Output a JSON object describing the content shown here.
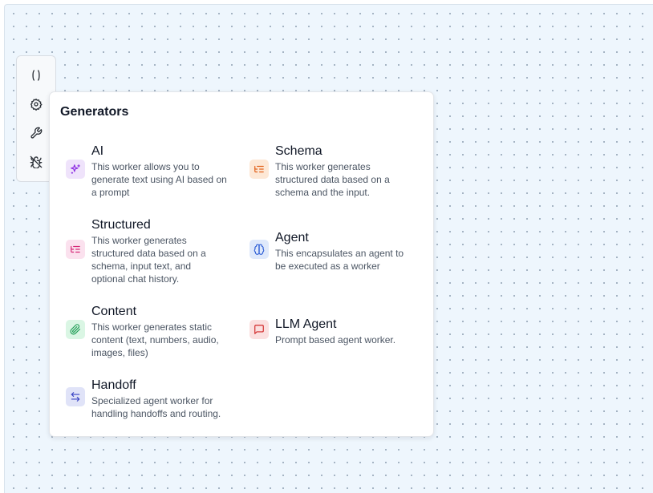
{
  "toolbar": {
    "tools": [
      {
        "icon": "braces-icon"
      },
      {
        "icon": "settings-icon"
      },
      {
        "icon": "wrench-icon"
      },
      {
        "icon": "bug-off-icon"
      }
    ]
  },
  "panel": {
    "title": "Generators",
    "items": [
      {
        "name": "AI",
        "description": "This worker allows you to generate text using AI based on a prompt",
        "icon": "sparkles-icon",
        "color": "#8b2be2"
      },
      {
        "name": "Schema",
        "description": "This worker generates structured data based on a schema and the input.",
        "icon": "list-tree-icon",
        "color": "#e2621b"
      },
      {
        "name": "Structured",
        "description": "This worker generates structured data based on a schema, input text, and optional chat history.",
        "icon": "list-tree-icon",
        "color": "#d62a78"
      },
      {
        "name": "Agent",
        "description": "This encapsulates an agent to be executed as a worker",
        "icon": "brain-icon",
        "color": "#2f5fd6"
      },
      {
        "name": "Content",
        "description": "This worker generates static content (text, numbers, audio, images, files)",
        "icon": "paperclip-icon",
        "color": "#1f9d55"
      },
      {
        "name": "LLM Agent",
        "description": "Prompt based agent worker.",
        "icon": "message-square-icon",
        "color": "#d12a2a"
      },
      {
        "name": "Handoff",
        "description": "Specialized agent worker for handling handoffs and routing.",
        "icon": "arrow-left-right-icon",
        "color": "#3b45c4"
      }
    ]
  }
}
